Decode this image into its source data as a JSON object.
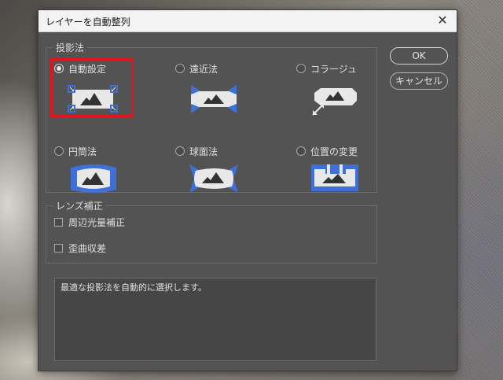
{
  "dialog": {
    "title": "レイヤーを自動整列",
    "close_glyph": "✕"
  },
  "projection": {
    "legend": "投影法",
    "selected": "auto",
    "options": [
      {
        "id": "auto",
        "label": "自動設定",
        "checked": true
      },
      {
        "id": "perspective",
        "label": "遠近法",
        "checked": false
      },
      {
        "id": "collage",
        "label": "コラージュ",
        "checked": false
      },
      {
        "id": "cylindrical",
        "label": "円筒法",
        "checked": false
      },
      {
        "id": "spherical",
        "label": "球面法",
        "checked": false
      },
      {
        "id": "reposition",
        "label": "位置の変更",
        "checked": false
      }
    ]
  },
  "lens_correction": {
    "legend": "レンズ補正",
    "options": [
      {
        "id": "vignette",
        "label": "周辺光量補正",
        "checked": false
      },
      {
        "id": "distortion",
        "label": "歪曲収差",
        "checked": false
      }
    ]
  },
  "buttons": {
    "ok": "OK",
    "cancel": "キャンセル"
  },
  "description": "最適な投影法を自動的に選択します。",
  "colors": {
    "dialog_bg": "#535353",
    "accent_blue": "#3f6fd8",
    "thumb_light": "#e8e8e8",
    "highlight_red": "#e3141b"
  },
  "icons": [
    "close-icon",
    "auto-thumbnail-icon",
    "perspective-thumbnail-icon",
    "collage-thumbnail-icon",
    "cylindrical-thumbnail-icon",
    "spherical-thumbnail-icon",
    "reposition-thumbnail-icon"
  ]
}
